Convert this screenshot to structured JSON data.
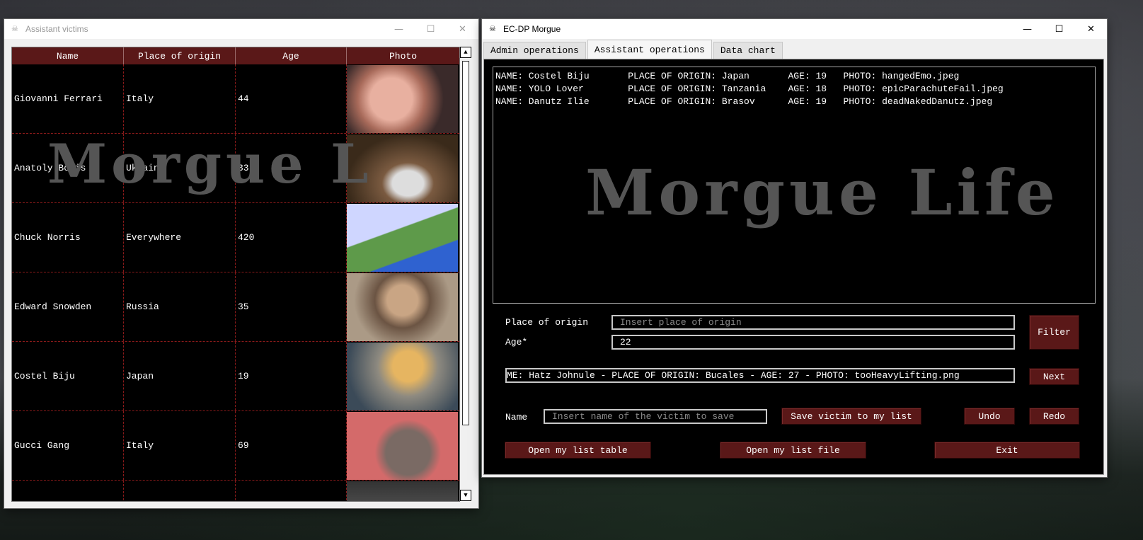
{
  "colors": {
    "header_red": "#5a1818",
    "button_red": "#5a1818",
    "grid_red": "#8a1a1a",
    "watermark": "#555555"
  },
  "left_window": {
    "title": "Assistant victims",
    "icon": "skull-icon",
    "columns": [
      "Name",
      "Place of origin",
      "Age",
      "Photo"
    ],
    "rows": [
      {
        "name": "Giovanni Ferrari",
        "origin": "Italy",
        "age": "44",
        "photo": "man-with-glasses-photo"
      },
      {
        "name": "Anatoly Boris",
        "origin": "Ukraine",
        "age": "33",
        "photo": "cat-photo"
      },
      {
        "name": "Chuck Norris",
        "origin": "Everywhere",
        "age": "420",
        "photo": "frog-cartoon-photo"
      },
      {
        "name": "Edward Snowden",
        "origin": "Russia",
        "age": "35",
        "photo": "mustache-man-photo"
      },
      {
        "name": "Costel Biju",
        "origin": "Japan",
        "age": "19",
        "photo": "dancing-dog-photo"
      },
      {
        "name": "Gucci Gang",
        "origin": "Italy",
        "age": "69",
        "photo": "cartoon-cat-sunglasses-photo"
      },
      {
        "name": "",
        "origin": "",
        "age": "",
        "photo": "partial-photo"
      }
    ],
    "watermark": "Morgue L"
  },
  "right_window": {
    "title": "EC-DP Morgue",
    "icon": "skull-icon",
    "tabs": [
      "Admin operations",
      "Assistant operations",
      "Data chart"
    ],
    "active_tab": "Assistant operations",
    "list": [
      "NAME: Costel Biju       PLACE OF ORIGIN: Japan       AGE: 19   PHOTO: hangedEmo.jpeg",
      "NAME: YOLO Lover        PLACE OF ORIGIN: Tanzania    AGE: 18   PHOTO: epicParachuteFail.jpeg",
      "NAME: Danutz Ilie       PLACE OF ORIGIN: Brasov      AGE: 19   PHOTO: deadNakedDanutz.jpeg"
    ],
    "watermark": "Morgue Life",
    "place_label": "Place of origin",
    "place_placeholder": "Insert place of origin",
    "age_label": "Age*",
    "age_value": "22",
    "filter_button": "Filter",
    "next_value": "ME: Hatz Johnule - PLACE OF ORIGIN: Bucales - AGE: 27 - PHOTO: tooHeavyLifting.png",
    "next_button": "Next",
    "name_label": "Name",
    "name_placeholder": "Insert name of the victim to save",
    "save_button": "Save victim to my list",
    "undo_button": "Undo",
    "redo_button": "Redo",
    "open_table_button": "Open my list table",
    "open_file_button": "Open my list file",
    "exit_button": "Exit"
  }
}
